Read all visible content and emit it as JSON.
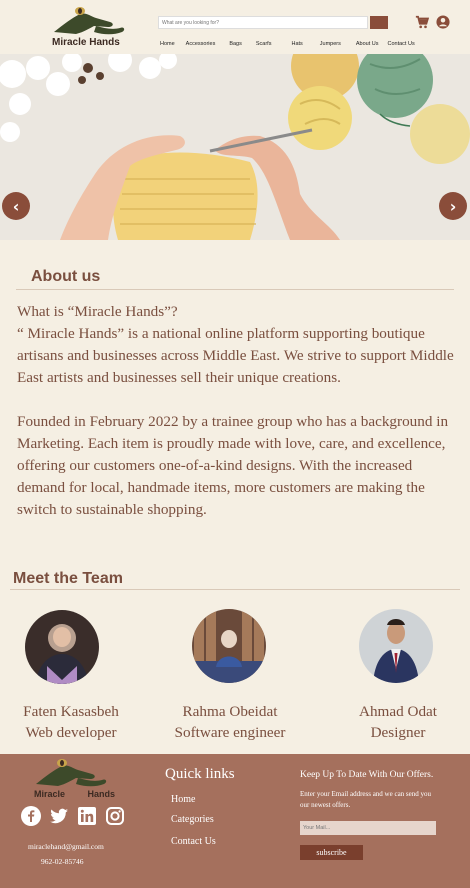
{
  "brand": {
    "name_part1": "Miracle",
    "name_part2": "Hands"
  },
  "header": {
    "search_placeholder": "What are you looking for?",
    "nav": [
      "Home",
      "Accessories",
      "Bags",
      "Scarfs",
      "Hats",
      "Jumpers",
      "About Us",
      "Contact Us"
    ]
  },
  "hero": {
    "prev_icon": "chevron-left-icon",
    "next_icon": "chevron-right-icon"
  },
  "about": {
    "title": "About us",
    "p1_line1": "What is “Miracle Hands”?",
    "p1_rest": "“ Miracle Hands” is a national online platform supporting boutique artisans and businesses across Middle East. We strive to support Middle East artists and businesses sell their unique creations.",
    "p2": "Founded in February 2022 by a trainee group who has a background in Marketing. Each item is proudly made with love, care, and excellence, offering our customers one-of-a-kind designs. With the increased demand for local, handmade items, more customers are making the switch to sustainable shopping."
  },
  "team": {
    "title": "Meet the Team",
    "members": [
      {
        "name": "Faten Kasasbeh",
        "role": "Web developer"
      },
      {
        "name": "Rahma Obeidat",
        "role": "Software engineer"
      },
      {
        "name": "Ahmad Odat",
        "role": "Designer"
      }
    ]
  },
  "footer": {
    "email": "miraclehand@gmail.com",
    "phone": "962-02-85746",
    "quick_links_title": "Quick links",
    "quick_links": [
      "Home",
      "Categories",
      "Contact Us"
    ],
    "newsletter_title": "Keep Up To Date With Our Offers.",
    "newsletter_desc": "Enter your Email address and we can send you our newest offers.",
    "newsletter_placeholder": "Your Mail...",
    "subscribe_label": "subscribe",
    "social_icons": [
      "facebook-icon",
      "twitter-icon",
      "linkedin-icon",
      "instagram-icon"
    ]
  },
  "colors": {
    "background": "#f5efe3",
    "brand_brown": "#8a4d3a",
    "footer": "#a5705d",
    "text": "#7a4f3f"
  }
}
